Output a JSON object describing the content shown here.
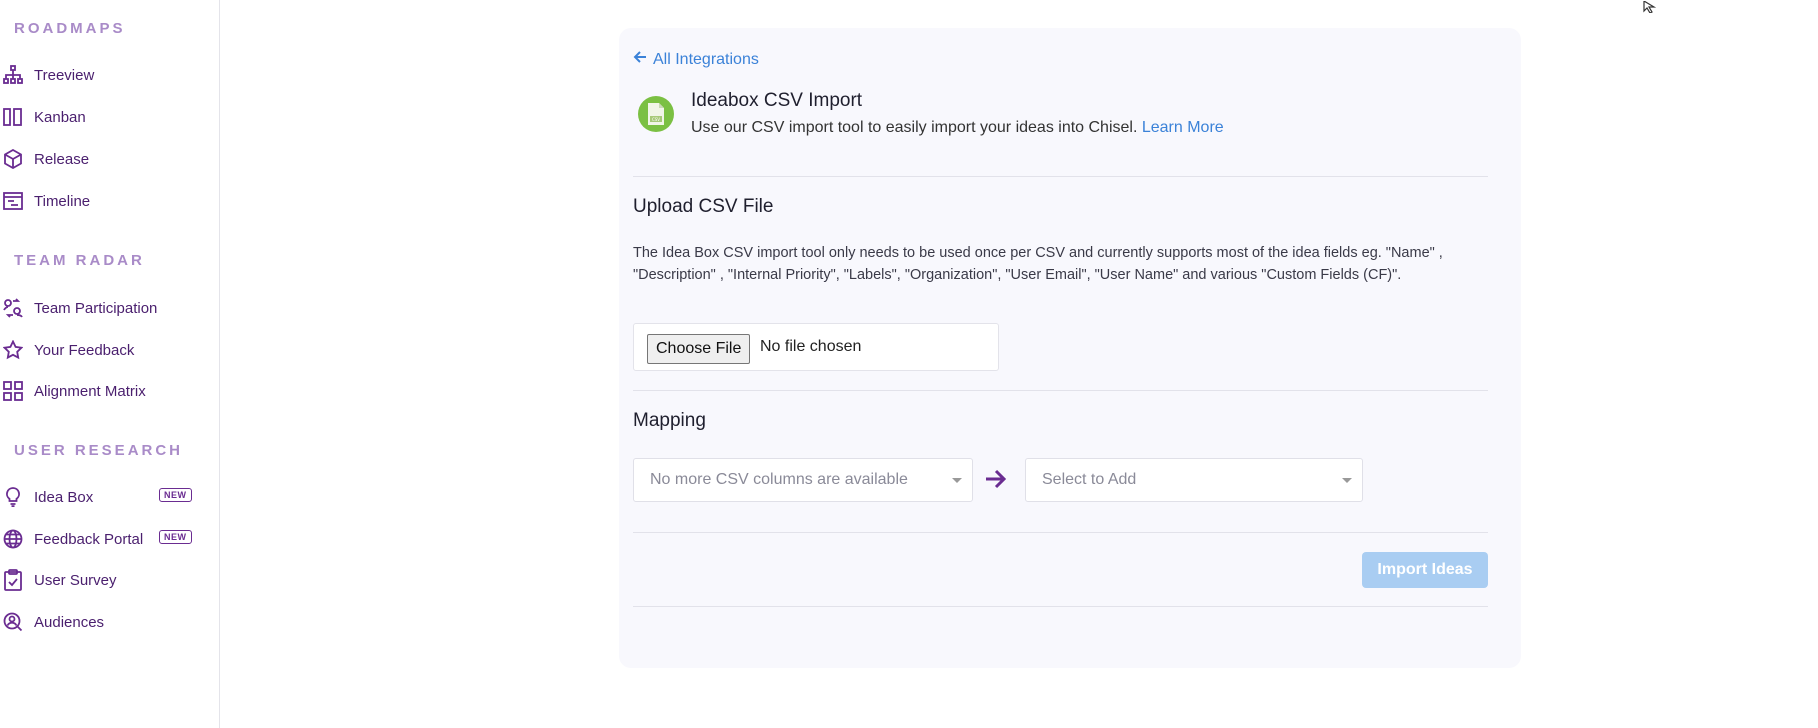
{
  "sidebar": {
    "sections": [
      {
        "title": "ROADMAPS",
        "items": [
          {
            "label": "Treeview",
            "icon": "hierarchy-icon"
          },
          {
            "label": "Kanban",
            "icon": "kanban-icon"
          },
          {
            "label": "Release",
            "icon": "box-icon"
          },
          {
            "label": "Timeline",
            "icon": "timeline-icon"
          }
        ]
      },
      {
        "title": "TEAM RADAR",
        "items": [
          {
            "label": "Team Participation",
            "icon": "team-icon"
          },
          {
            "label": "Your Feedback",
            "icon": "star-icon"
          },
          {
            "label": "Alignment Matrix",
            "icon": "grid-icon"
          }
        ]
      },
      {
        "title": "USER RESEARCH",
        "items": [
          {
            "label": "Idea Box",
            "icon": "lightbulb-icon",
            "badge": "NEW"
          },
          {
            "label": "Feedback Portal",
            "icon": "globe-icon",
            "badge": "NEW"
          },
          {
            "label": "User Survey",
            "icon": "clipboard-check-icon"
          },
          {
            "label": "Audiences",
            "icon": "user-search-icon"
          }
        ]
      }
    ]
  },
  "integration": {
    "back_label": "All Integrations",
    "title": "Ideabox CSV Import",
    "description": "Use our CSV import tool to easily import your ideas into Chisel.",
    "learn_more": "Learn More",
    "icon": "csv-file-icon"
  },
  "upload": {
    "heading": "Upload CSV File",
    "description": "The Idea Box CSV import tool only needs to be used once per CSV and currently supports most of the idea fields eg. \"Name\" , \"Description\" , \"Internal Priority\", \"Labels\", \"Organization\", \"User Email\", \"User Name\" and various \"Custom Fields (CF)\".",
    "choose_file_label": "Choose File",
    "file_status": "No file chosen"
  },
  "mapping": {
    "heading": "Mapping",
    "csv_column_select": "No more CSV columns are available",
    "target_select": "Select to Add"
  },
  "actions": {
    "import_label": "Import Ideas"
  },
  "colors": {
    "brand_purple": "#6a2c91",
    "link_blue": "#3b82d8",
    "disabled_button": "#a9cdf2",
    "card_background": "#f8f8fd"
  }
}
